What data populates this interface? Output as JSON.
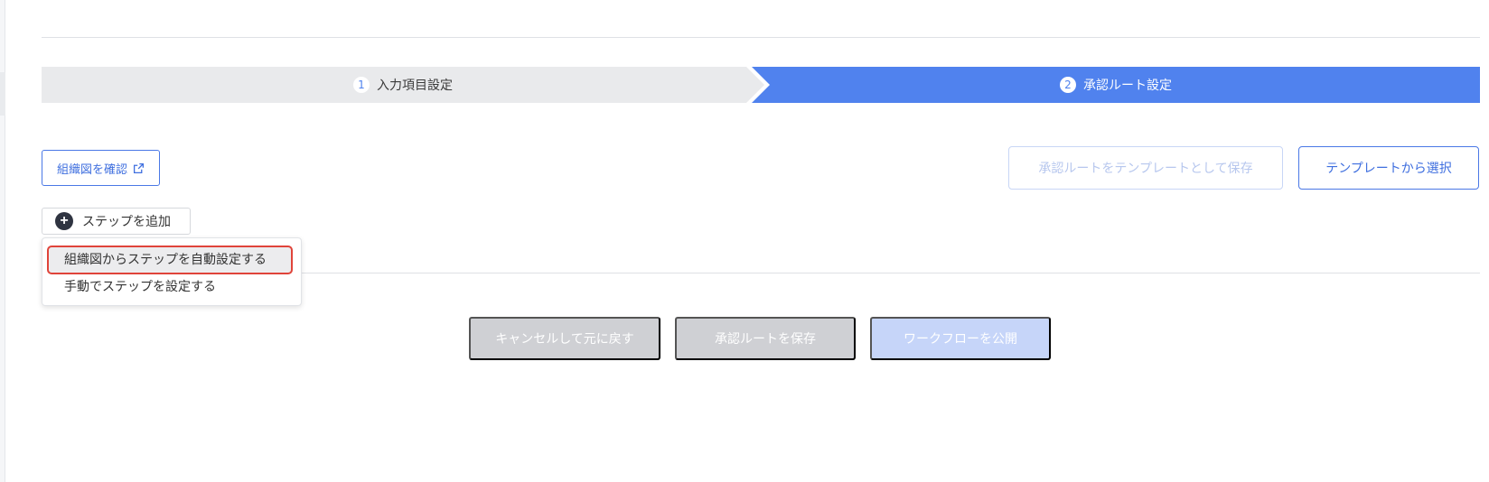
{
  "stepper": {
    "steps": [
      {
        "number": "1",
        "label": "入力項目設定",
        "active": false
      },
      {
        "number": "2",
        "label": "承認ルート設定",
        "active": true
      }
    ]
  },
  "toolbar": {
    "org_chart_button": "組織図を確認",
    "save_template_button": "承認ルートをテンプレートとして保存",
    "select_template_button": "テンプレートから選択",
    "add_step_button": "ステップを追加"
  },
  "dropdown": {
    "items": [
      {
        "label": "組織図からステップを自動設定する",
        "highlighted": true
      },
      {
        "label": "手動でステップを設定する",
        "highlighted": false
      }
    ]
  },
  "actions": {
    "cancel": "キャンセルして元に戻す",
    "save_route": "承認ルートを保存",
    "publish": "ワークフローを公開"
  },
  "colors": {
    "accent": "#5082ee",
    "inactive_step": "#e9eaec",
    "highlight_border": "#e0443a",
    "disabled_button": "#cfd0d4",
    "disabled_primary": "#c6d5f9"
  },
  "icons": {
    "org_chart_external": "external-link-icon",
    "add_step": "plus-circle-icon"
  }
}
